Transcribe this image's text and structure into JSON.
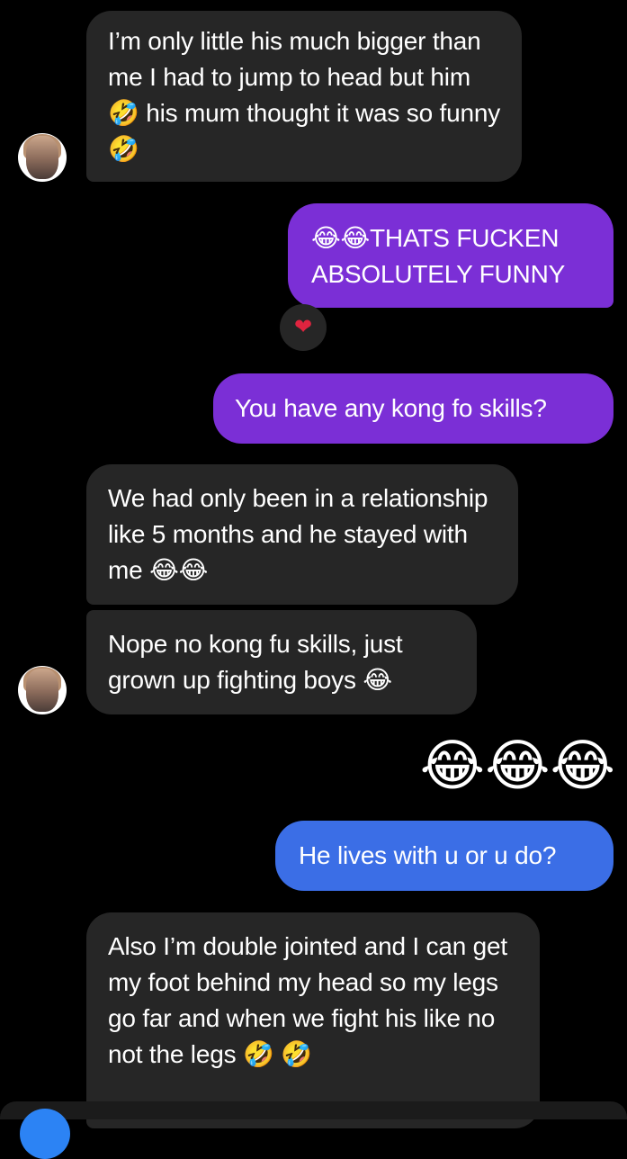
{
  "messages": [
    {
      "text": "I’m only little his much bigger than me I had to jump to head but him 🤣 his mum thought it was so funny 🤣"
    },
    {
      "text": "😂😂THATS FUCKEN ABSOLUTELY FUNNY",
      "reaction": "❤"
    },
    {
      "text": "You have any kong fo skills?"
    },
    {
      "text": "We had only been in a relationship like 5 months and he stayed with me 😂😂"
    },
    {
      "text": "Nope no kong fu skills, just grown up fighting boys 😂"
    },
    {
      "text": "😂😂😂"
    },
    {
      "text": "He lives with u or u do?"
    },
    {
      "text": "Also I’m double jointed and I can get my foot behind my head so my legs go far and when we fight his like no not the legs 🤣 🤣"
    }
  ],
  "colors": {
    "background": "#000000",
    "incoming_bubble": "#262626",
    "outgoing_purple": "#7b2fd6",
    "outgoing_blue": "#3b6ee6",
    "heart": "#e0243f"
  }
}
